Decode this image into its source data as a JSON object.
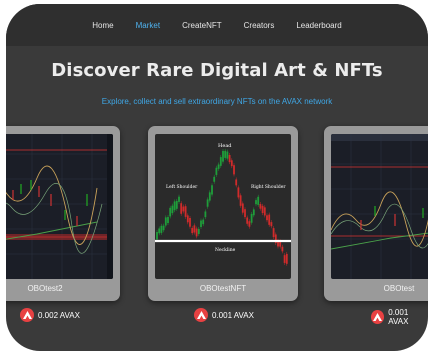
{
  "nav": {
    "items": [
      "Home",
      "Market",
      "CreateNFT",
      "Creators",
      "Leaderboard"
    ],
    "active": "Market"
  },
  "hero": {
    "title": "Discover Rare Digital Art & NFTs",
    "subtitle": "Explore, collect and sell extraordinary NFTs on the AVAX network"
  },
  "cards": [
    {
      "name": "OBOtest2",
      "price": "0.002 AVAX"
    },
    {
      "name": "OBOtestNFT",
      "price": "0.001 AVAX"
    },
    {
      "name": "OBOtest",
      "price": "0.001 AVAX"
    }
  ],
  "chart_labels": {
    "head": "Head",
    "left_shoulder": "Left Shoulder",
    "right_shoulder": "Right Shoulder",
    "neckline": "Neckline"
  },
  "colors": {
    "accent": "#4fb3f0",
    "avax_red": "#e84142",
    "bull": "#1e9e3a",
    "bear": "#d12b2b"
  },
  "icons": {
    "price": "avax-logo-icon"
  }
}
